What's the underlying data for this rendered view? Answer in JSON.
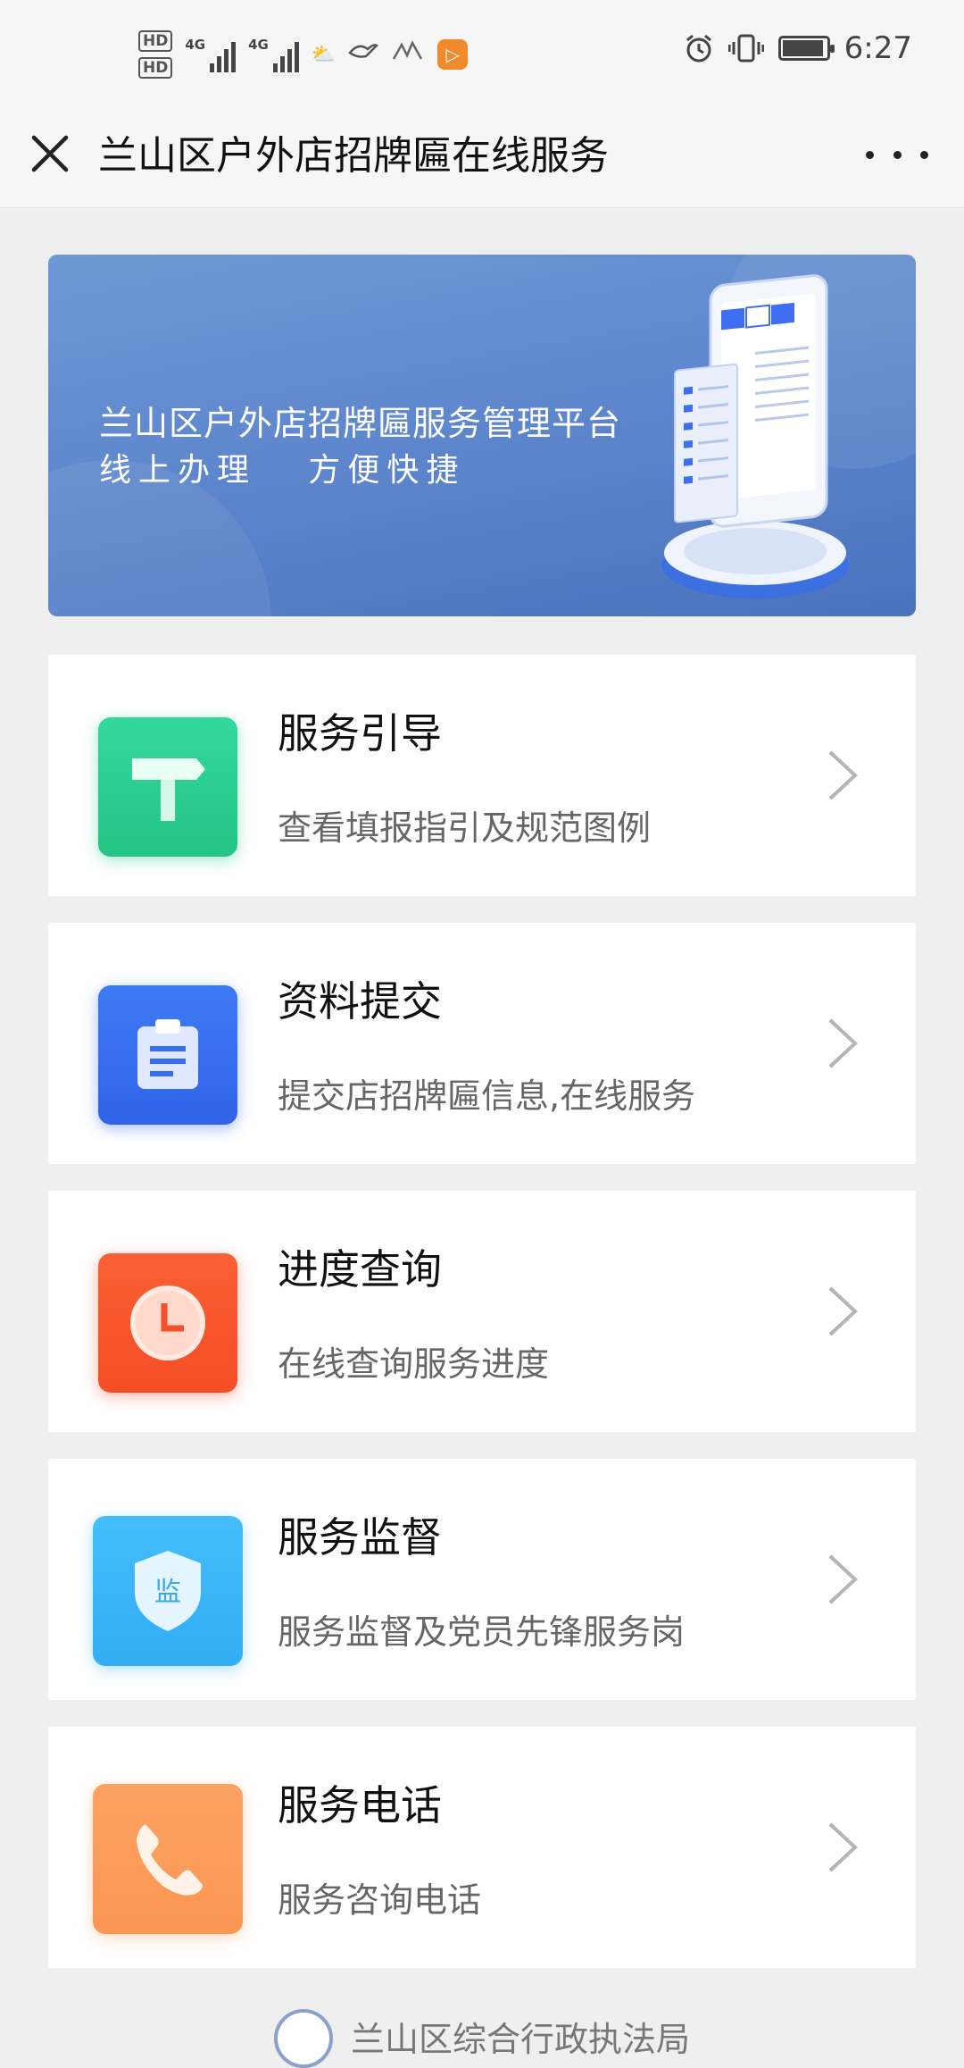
{
  "status_bar": {
    "hd1": "HD",
    "hd2": "HD",
    "net1": "4G",
    "net2": "4G",
    "time": "6:27",
    "battery_level": 0.95,
    "icons": [
      "weather-icon",
      "bird-icon",
      "study-app-icon",
      "video-app-icon",
      "alarm-icon",
      "vibrate-icon",
      "battery-icon"
    ]
  },
  "nav": {
    "title": "兰山区户外店招牌匾在线服务"
  },
  "banner": {
    "line1": "兰山区户外店招牌匾服务管理平台",
    "line2": "线上办理   方便快捷"
  },
  "menu": [
    {
      "title": "服务引导",
      "desc": "查看填报指引及规范图例",
      "icon": "signpost-icon",
      "color": "#2fcf93"
    },
    {
      "title": "资料提交",
      "desc": "提交店招牌匾信息,在线服务",
      "icon": "clipboard-icon",
      "color": "#356ef0"
    },
    {
      "title": "进度查询",
      "desc": "在线查询服务进度",
      "icon": "clock-icon",
      "color": "#f9572e"
    },
    {
      "title": "服务监督",
      "desc": "服务监督及党员先锋服务岗",
      "icon": "shield-icon",
      "color": "#3db4f7",
      "icon_text": "监"
    },
    {
      "title": "服务电话",
      "desc": "服务咨询电话",
      "icon": "phone-icon",
      "color": "#fb9f5b"
    }
  ],
  "footer": {
    "org": "兰山区综合行政执法局"
  }
}
